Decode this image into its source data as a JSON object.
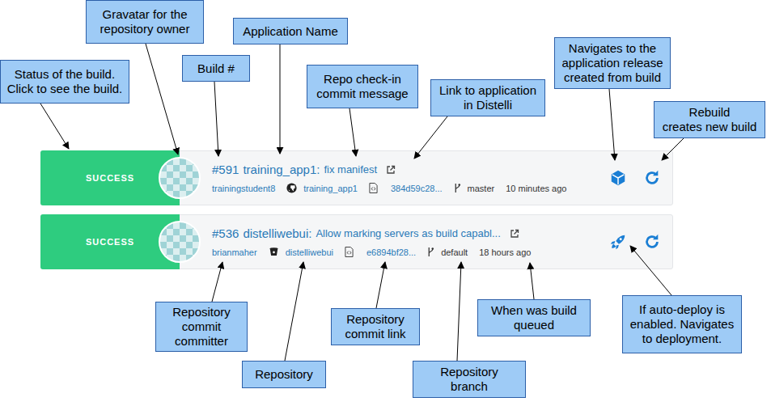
{
  "builds": [
    {
      "status": "SUCCESS",
      "number": "#591",
      "app": "training_app1:",
      "message": "fix manifest",
      "committer": "trainingstudent8",
      "repo": "training_app1",
      "repo_kind": "github",
      "commit": "384d59c28...",
      "branch": "master",
      "queued": "10 minutes ago",
      "action_kind": "release"
    },
    {
      "status": "SUCCESS",
      "number": "#536",
      "app": "distelliwebui:",
      "message": "Allow marking servers as build capabl...",
      "committer": "brianmaher",
      "repo": "distelliwebui",
      "repo_kind": "bitbucket",
      "commit": "e6894bf28...",
      "branch": "default",
      "queued": "18 hours ago",
      "action_kind": "deploy"
    }
  ],
  "callouts": [
    {
      "text": "Status of the build.\nClick to see the build."
    },
    {
      "text": "Gravatar for the\nrepository owner"
    },
    {
      "text": "Build #"
    },
    {
      "text": "Application Name"
    },
    {
      "text": "Repo check-in\ncommit message"
    },
    {
      "text": "Link to application\nin Distelli"
    },
    {
      "text": "Navigates to the\napplication release\ncreated from build"
    },
    {
      "text": "Rebuild\ncreates new build"
    },
    {
      "text": "Repository\ncommit\ncommitter"
    },
    {
      "text": "Repository"
    },
    {
      "text": "Repository\ncommit link"
    },
    {
      "text": "When was build\nqueued"
    },
    {
      "text": "Repository\nbranch"
    },
    {
      "text": "If auto-deploy is\nenabled. Navigates\nto deployment."
    }
  ]
}
